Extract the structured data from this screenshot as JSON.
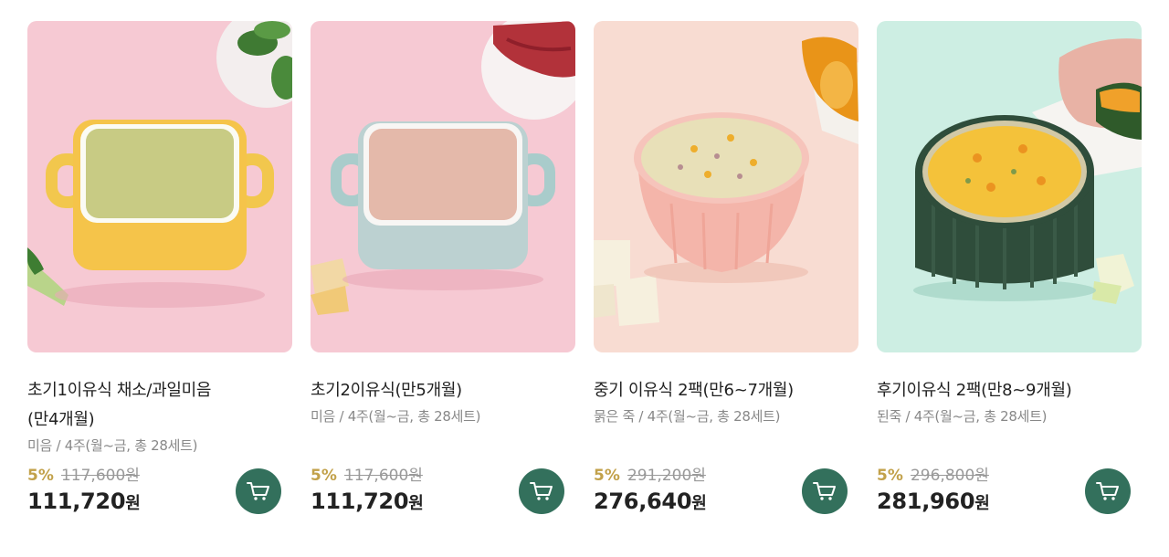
{
  "products": [
    {
      "title": "초기1이유식 채소/과일미음",
      "title_line2": "(만4개월)",
      "desc": "미음 / 4주(월~금, 총 28세트)",
      "discount": "5%",
      "original_price": "117,600원",
      "price": "111,720",
      "currency": "원",
      "bg_color": "#f4c6d0"
    },
    {
      "title": "초기2이유식(만5개월)",
      "title_line2": "",
      "desc": "미음 / 4주(월~금, 총 28세트)",
      "discount": "5%",
      "original_price": "117,600원",
      "price": "111,720",
      "currency": "원",
      "bg_color": "#f4c6d0"
    },
    {
      "title": "중기 이유식 2팩(만6~7개월)",
      "title_line2": "",
      "desc": "묽은 죽 / 4주(월~금, 총 28세트)",
      "discount": "5%",
      "original_price": "291,200원",
      "price": "276,640",
      "currency": "원",
      "bg_color": "#f6d9cf"
    },
    {
      "title": "후기이유식 2팩(만8~9개월)",
      "title_line2": "",
      "desc": "된죽 / 4주(월~금, 총 28세트)",
      "discount": "5%",
      "original_price": "296,800원",
      "price": "281,960",
      "currency": "원",
      "bg_color": "#c8eadf"
    }
  ],
  "icons": {
    "cart": "cart-icon"
  },
  "colors": {
    "accent_green": "#33705c",
    "discount_gold": "#c2a14a"
  }
}
